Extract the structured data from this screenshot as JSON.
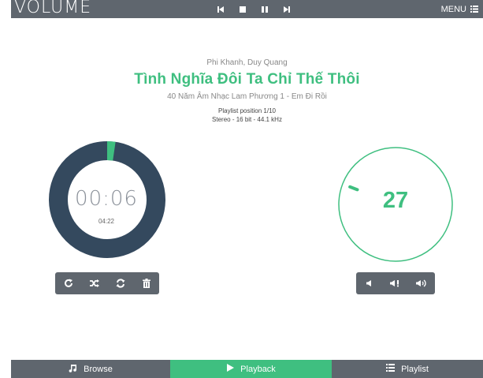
{
  "header": {
    "logo": "VOLUME",
    "menu_label": "MENU",
    "transport": [
      "previous-icon",
      "stop-icon",
      "pause-icon",
      "next-icon"
    ]
  },
  "track": {
    "artist": "Phi Khanh, Duy Quang",
    "title": "Tình Nghĩa Đôi Ta Chỉ Thế Thôi",
    "album": "40 Năm Âm Nhạc Lam Phương 1 - Em Đi Rồi",
    "playlist_position": "Playlist position 1/10",
    "format": "Stereo - 16 bit - 44.1 kHz"
  },
  "playback": {
    "elapsed": "00:06",
    "duration": "04:22",
    "progress_fraction": 0.023
  },
  "volume": {
    "level": "27",
    "level_fraction": 0.27
  },
  "playback_controls": [
    "repeat-icon",
    "shuffle-icon",
    "refresh-icon",
    "trash-icon"
  ],
  "volume_controls": [
    "volume-down-icon",
    "mute-icon",
    "volume-up-icon"
  ],
  "tabs": [
    {
      "label": "Browse",
      "icon": "music-note-icon"
    },
    {
      "label": "Playback",
      "icon": "play-icon",
      "active": true
    },
    {
      "label": "Playlist",
      "icon": "list-icon"
    }
  ],
  "colors": {
    "accent": "#3fbf80",
    "bar": "#5f666e",
    "ring_dark": "#34495e"
  }
}
